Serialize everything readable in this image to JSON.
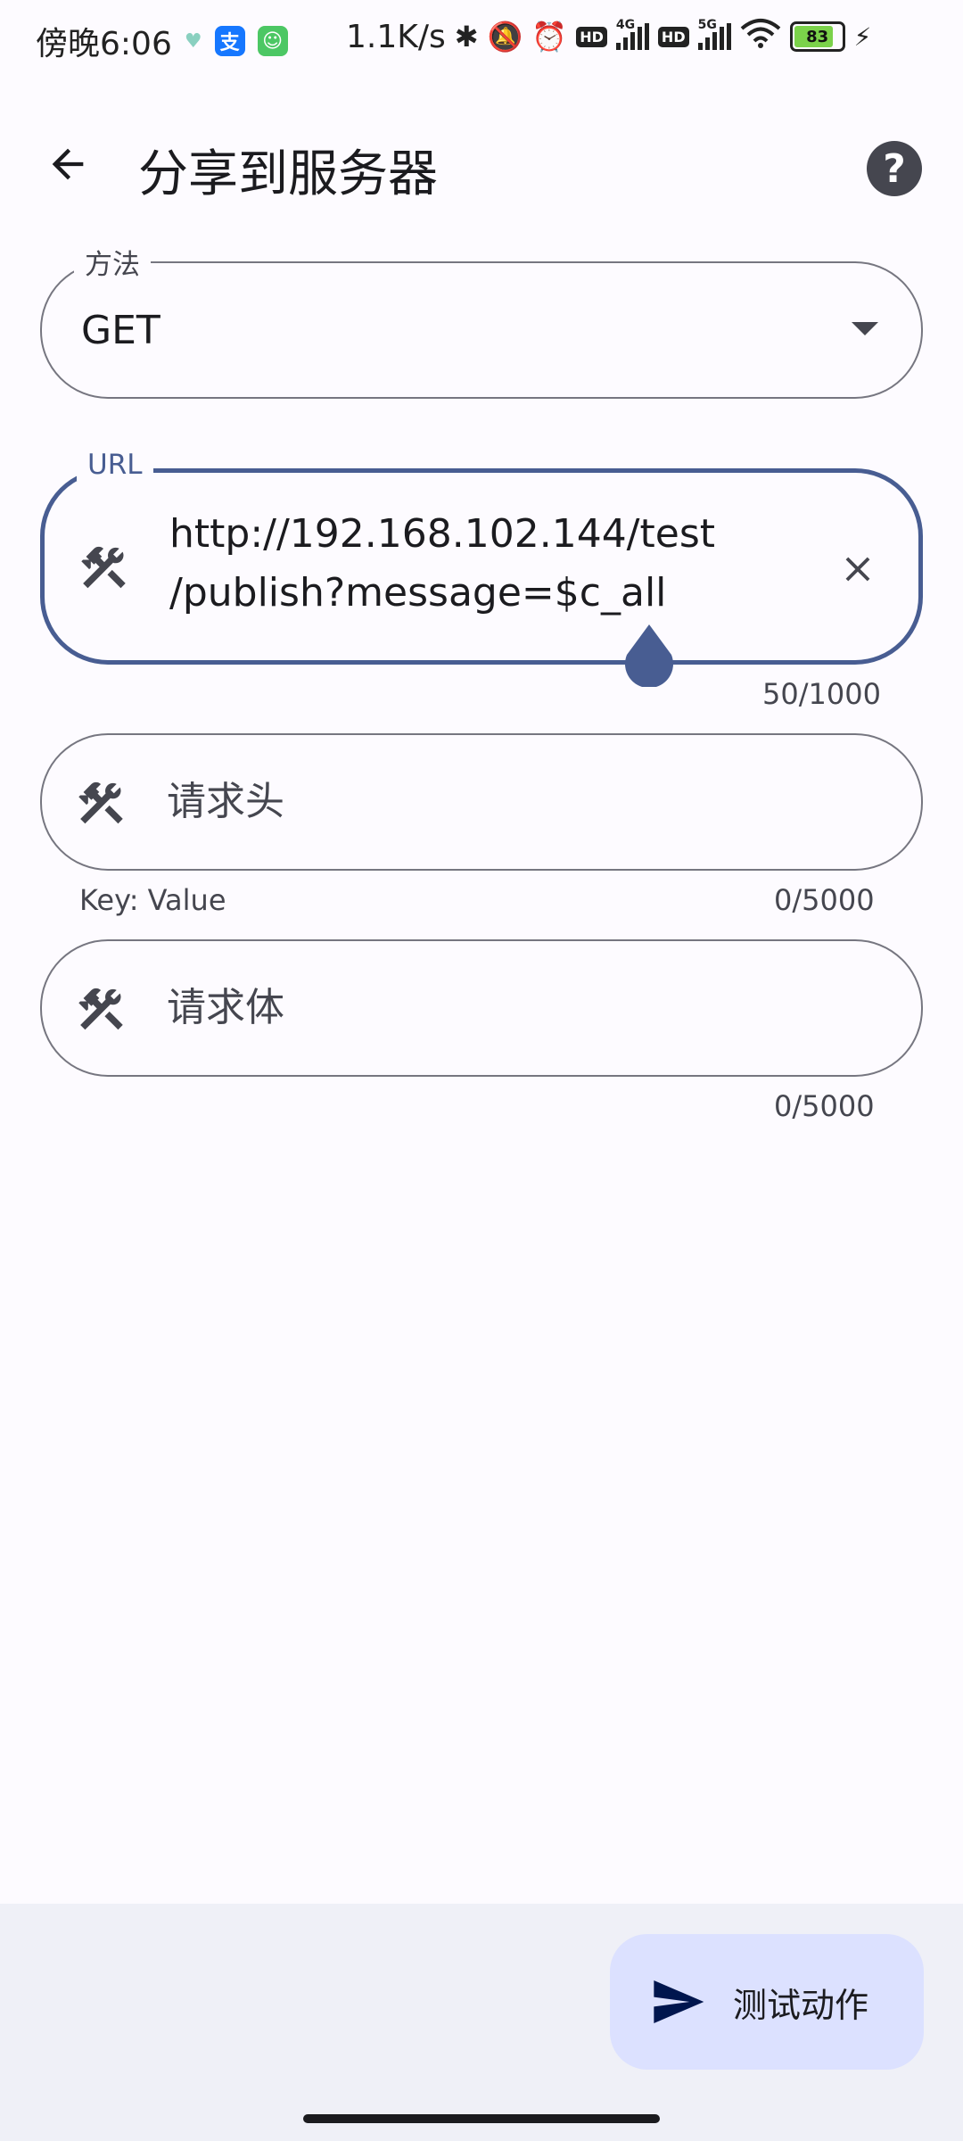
{
  "status_bar": {
    "time": "傍晚6:06",
    "net_speed": "1.1K/s",
    "battery": "83",
    "signal1_tag": "4G",
    "signal2_tag": "5G",
    "hd_label": "HD"
  },
  "appbar": {
    "title": "分享到服务器"
  },
  "method": {
    "label": "方法",
    "value": "GET"
  },
  "url": {
    "label": "URL",
    "value_line1": "http://192.168.102.144/test",
    "value_line2": "/publish?message=$c_all",
    "counter": "50/1000"
  },
  "headers": {
    "placeholder": "请求头",
    "helper": "Key: Value",
    "counter": "0/5000"
  },
  "body": {
    "placeholder": "请求体",
    "counter": "0/5000"
  },
  "fab": {
    "label": "测试动作"
  },
  "colors": {
    "primary": "#485d92",
    "fab_bg": "#dce1ff",
    "background": "#fdfbff",
    "bottom_bar": "#eff0f7"
  }
}
